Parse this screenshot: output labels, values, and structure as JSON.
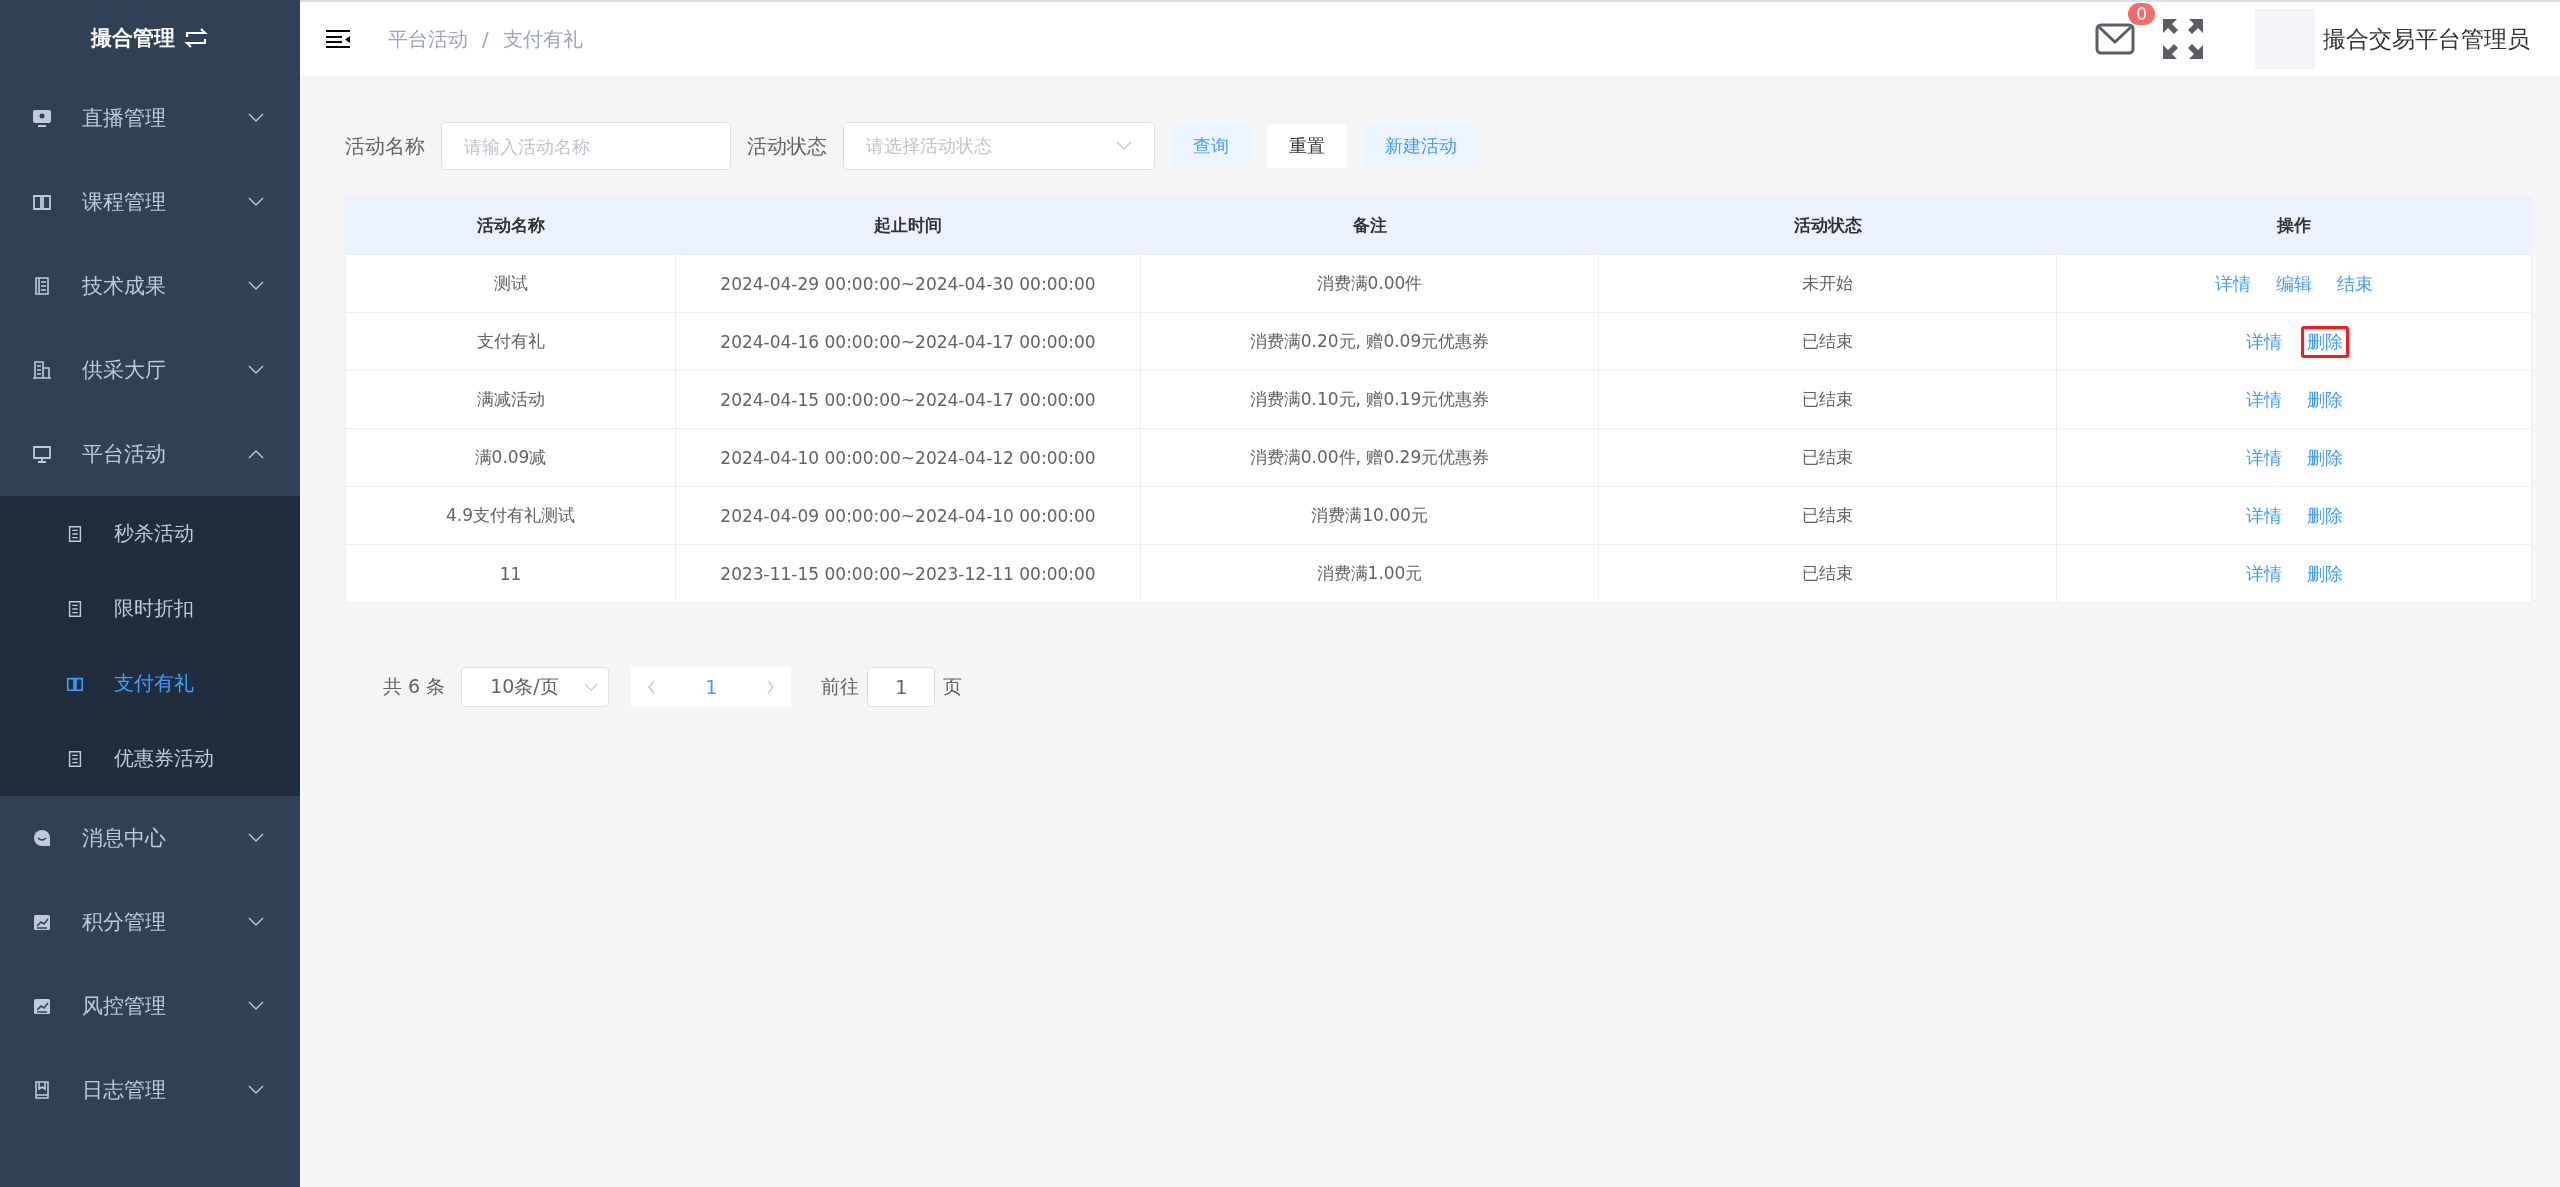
{
  "sidebar": {
    "title": "撮合管理",
    "items": [
      {
        "label": "直播管理",
        "expanded": false
      },
      {
        "label": "课程管理",
        "expanded": false
      },
      {
        "label": "技术成果",
        "expanded": false
      },
      {
        "label": "供采大厅",
        "expanded": false
      },
      {
        "label": "平台活动",
        "expanded": true,
        "children": [
          {
            "label": "秒杀活动",
            "selected": false
          },
          {
            "label": "限时折扣",
            "selected": false
          },
          {
            "label": "支付有礼",
            "selected": true
          },
          {
            "label": "优惠券活动",
            "selected": false
          }
        ]
      },
      {
        "label": "消息中心",
        "expanded": false
      },
      {
        "label": "积分管理",
        "expanded": false
      },
      {
        "label": "风控管理",
        "expanded": false
      },
      {
        "label": "日志管理",
        "expanded": false
      }
    ]
  },
  "header": {
    "breadcrumb": [
      "平台活动",
      "支付有礼"
    ],
    "breadcrumb_separator": "/",
    "mail_badge": "0",
    "user_name": "撮合交易平台管理员"
  },
  "filters": [
    {
      "label": "活动名称",
      "placeholder": "请输入活动名称",
      "kind": "input"
    },
    {
      "label": "活动状态",
      "placeholder": "请选择活动状态",
      "kind": "select"
    }
  ],
  "buttons": [
    {
      "label": "查询",
      "kind": "primary"
    },
    {
      "label": "重置",
      "kind": "plain"
    },
    {
      "label": "新建活动",
      "kind": "primary"
    }
  ],
  "table": {
    "columns": [
      "活动名称",
      "起止时间",
      "备注",
      "活动状态",
      "操作"
    ],
    "rows": [
      {
        "cells": [
          "测试",
          "2024-04-29 00:00:00~2024-04-30 00:00:00",
          "消费满0.00件",
          "未开始"
        ],
        "actions": [
          {
            "label": "详情",
            "highlighted": false
          },
          {
            "label": "编辑",
            "highlighted": false
          },
          {
            "label": "结束",
            "highlighted": false
          }
        ]
      },
      {
        "cells": [
          "支付有礼",
          "2024-04-16 00:00:00~2024-04-17 00:00:00",
          "消费满0.20元, 赠0.09元优惠券",
          "已结束"
        ],
        "actions": [
          {
            "label": "详情",
            "highlighted": false
          },
          {
            "label": "删除",
            "highlighted": true
          }
        ]
      },
      {
        "cells": [
          "满减活动",
          "2024-04-15 00:00:00~2024-04-17 00:00:00",
          "消费满0.10元, 赠0.19元优惠券",
          "已结束"
        ],
        "actions": [
          {
            "label": "详情",
            "highlighted": false
          },
          {
            "label": "删除",
            "highlighted": false
          }
        ]
      },
      {
        "cells": [
          "满0.09减",
          "2024-04-10 00:00:00~2024-04-12 00:00:00",
          "消费满0.00件, 赠0.29元优惠券",
          "已结束"
        ],
        "actions": [
          {
            "label": "详情",
            "highlighted": false
          },
          {
            "label": "删除",
            "highlighted": false
          }
        ]
      },
      {
        "cells": [
          "4.9支付有礼测试",
          "2024-04-09 00:00:00~2024-04-10 00:00:00",
          "消费满10.00元",
          "已结束"
        ],
        "actions": [
          {
            "label": "详情",
            "highlighted": false
          },
          {
            "label": "删除",
            "highlighted": false
          }
        ]
      },
      {
        "cells": [
          "11",
          "2023-11-15 00:00:00~2023-12-11 00:00:00",
          "消费满1.00元",
          "已结束"
        ],
        "actions": [
          {
            "label": "详情",
            "highlighted": false
          },
          {
            "label": "删除",
            "highlighted": false
          }
        ]
      }
    ]
  },
  "pagination": {
    "total": "共 6 条",
    "page_size": "10条/页",
    "current_page": "1",
    "goto_label": "前往",
    "goto_value": "1",
    "page_suffix": "页"
  }
}
